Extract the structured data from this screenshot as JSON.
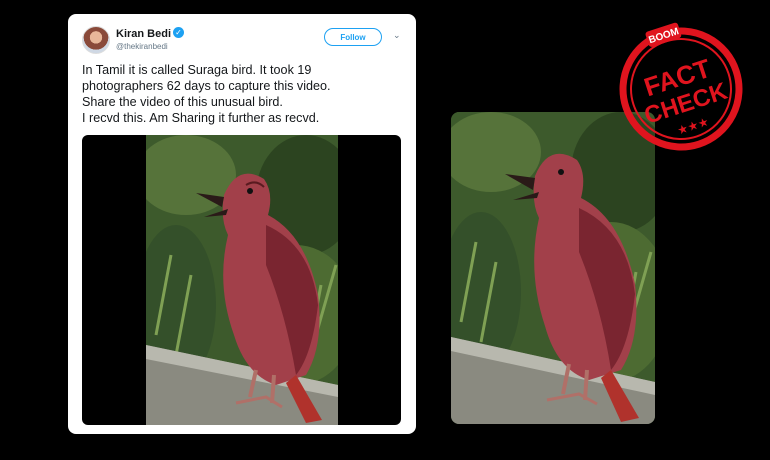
{
  "tweet": {
    "author_name": "Kiran Bedi",
    "author_handle": "@thekiranbedi",
    "follow_label": "Follow",
    "text_lines": [
      "In Tamil it is called Suraga bird. It took 19",
      "photographers 62 days to capture this video.",
      "Share the video of this unusual bird.",
      "I recvd this. Am Sharing it further as recvd."
    ]
  },
  "stamp": {
    "brand": "BOOM",
    "word1": "FACT",
    "word2": "CHECK",
    "color": "#e0141e"
  },
  "colors": {
    "accent": "#1da1f2",
    "background": "#000000"
  }
}
